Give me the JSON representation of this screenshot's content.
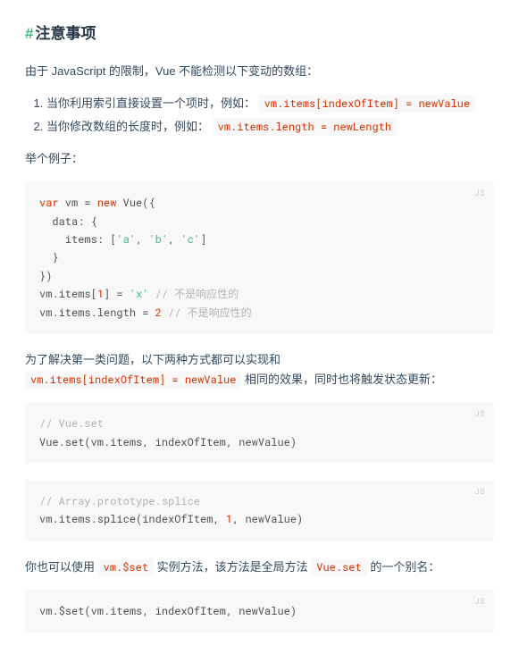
{
  "heading": {
    "hash": "#",
    "text": "注意事项"
  },
  "intro": "由于 JavaScript 的限制，Vue 不能检测以下变动的数组：",
  "list": {
    "item1_pre": "当你利用索引直接设置一个项时，例如：",
    "item1_code": "vm.items[indexOfItem] = newValue",
    "item2_pre": "当你修改数组的长度时，例如：",
    "item2_code": "vm.items.length = newLength"
  },
  "example_intro": "举个例子：",
  "lang_label": "JS",
  "code1": {
    "l1_kw_var": "var",
    "l1_rest": " vm = ",
    "l1_kw_new": "new",
    "l1_ctor": " Vue({",
    "l2": "  data: {",
    "l3_pre": "    items: [",
    "l3_a": "'a'",
    "l3_c1": ", ",
    "l3_b": "'b'",
    "l3_c2": ", ",
    "l3_c": "'c'",
    "l3_post": "]",
    "l4": "  }",
    "l5": "})",
    "l6_pre": "vm.items[",
    "l6_idx": "1",
    "l6_mid": "] = ",
    "l6_val": "'x'",
    "l6_sp": " ",
    "l6_cmt": "// 不是响应性的",
    "l7_pre": "vm.items.length = ",
    "l7_val": "2",
    "l7_sp": " ",
    "l7_cmt": "// 不是响应性的"
  },
  "para2_pre": "为了解决第一类问题，以下两种方式都可以实现和 ",
  "para2_code": "vm.items[indexOfItem] = newValue",
  "para2_post": " 相同的效果，同时也将触发状态更新：",
  "code2": {
    "l1_cmt": "// Vue.set",
    "l2": "Vue.set(vm.items, indexOfItem, newValue)"
  },
  "code3": {
    "l1_cmt": "// Array.prototype.splice",
    "l2_pre": "vm.items.splice(indexOfItem, ",
    "l2_num": "1",
    "l2_post": ", newValue)"
  },
  "para3_pre": "你也可以使用 ",
  "para3_code1": "vm.$set",
  "para3_mid": " 实例方法，该方法是全局方法 ",
  "para3_code2": "Vue.set",
  "para3_post": " 的一个别名：",
  "code4": {
    "l1": "vm.$set(vm.items, indexOfItem, newValue)"
  }
}
